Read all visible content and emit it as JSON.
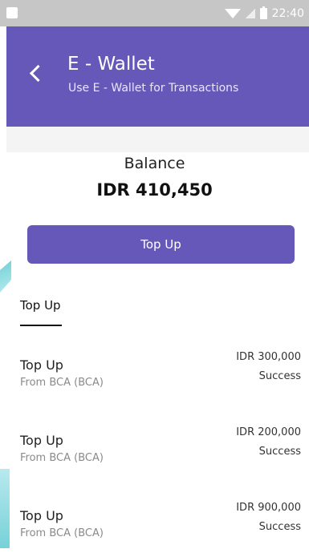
{
  "status_bar": {
    "time": "22:40",
    "icons": [
      "image-icon",
      "wifi-icon",
      "signal-icon",
      "battery-icon"
    ]
  },
  "header": {
    "title": "E - Wallet",
    "subtitle": "Use E - Wallet for Transactions",
    "back_icon": "chevron-left-icon"
  },
  "balance": {
    "label": "Balance",
    "value": "IDR 410,450"
  },
  "actions": {
    "topup_label": "Top Up"
  },
  "tabs": [
    {
      "label": "Top Up",
      "active": true
    }
  ],
  "transactions": [
    {
      "title": "Top Up",
      "from": "From BCA (BCA)",
      "amount": "IDR 300,000",
      "status": "Success"
    },
    {
      "title": "Top Up",
      "from": "From BCA (BCA)",
      "amount": "IDR 200,000",
      "status": "Success"
    },
    {
      "title": "Top Up",
      "from": "From BCA (BCA)",
      "amount": "IDR 900,000",
      "status": "Success"
    }
  ],
  "colors": {
    "primary": "#6558b8",
    "status_bar": "#c6c6c6",
    "muted_text": "#8a8a8a"
  }
}
